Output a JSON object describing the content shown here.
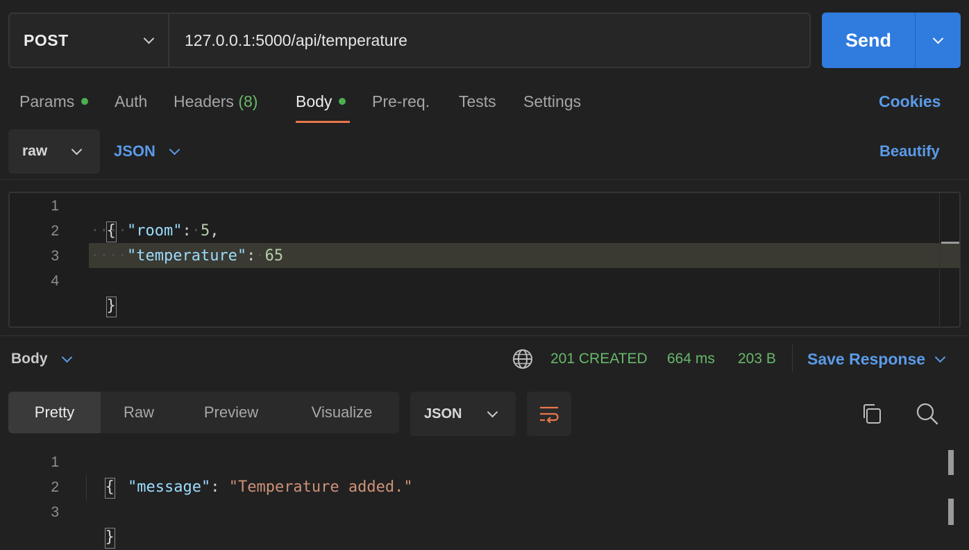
{
  "request": {
    "method": "POST",
    "url": "127.0.0.1:5000/api/temperature",
    "send_label": "Send"
  },
  "tabs": [
    {
      "label": "Params",
      "dot": true
    },
    {
      "label": "Auth"
    },
    {
      "label": "Headers",
      "count": "(8)"
    },
    {
      "label": "Body",
      "dot": true,
      "active": true
    },
    {
      "label": "Pre-req."
    },
    {
      "label": "Tests"
    },
    {
      "label": "Settings"
    }
  ],
  "cookies_label": "Cookies",
  "body_mode": {
    "mode": "raw",
    "language": "JSON",
    "beautify_label": "Beautify"
  },
  "request_body": {
    "line_numbers": [
      "1",
      "2",
      "3",
      "4"
    ],
    "open_brace": "{",
    "close_brace": "}",
    "key1": "\"room\"",
    "val1": "5",
    "key2": "\"temperature\"",
    "val2": "65"
  },
  "response": {
    "section_label": "Body",
    "status": "201 CREATED",
    "time": "664 ms",
    "size": "203 B",
    "save_label": "Save Response",
    "view_tabs": [
      "Pretty",
      "Raw",
      "Preview",
      "Visualize"
    ],
    "format": "JSON",
    "line_numbers": [
      "1",
      "2",
      "3"
    ],
    "open_brace": "{",
    "close_brace": "}",
    "key": "\"message\"",
    "value": "\"Temperature added.\""
  },
  "icons": {
    "method_dropdown": "chevron-down-icon",
    "globe": "globe-icon",
    "wrap": "wrap-lines-icon",
    "copy": "copy-icon",
    "search": "search-icon"
  },
  "colors": {
    "accent_blue": "#2f7bde",
    "link_blue": "#5a9be8",
    "status_green": "#68b86b",
    "tab_underline": "#e9774b"
  }
}
